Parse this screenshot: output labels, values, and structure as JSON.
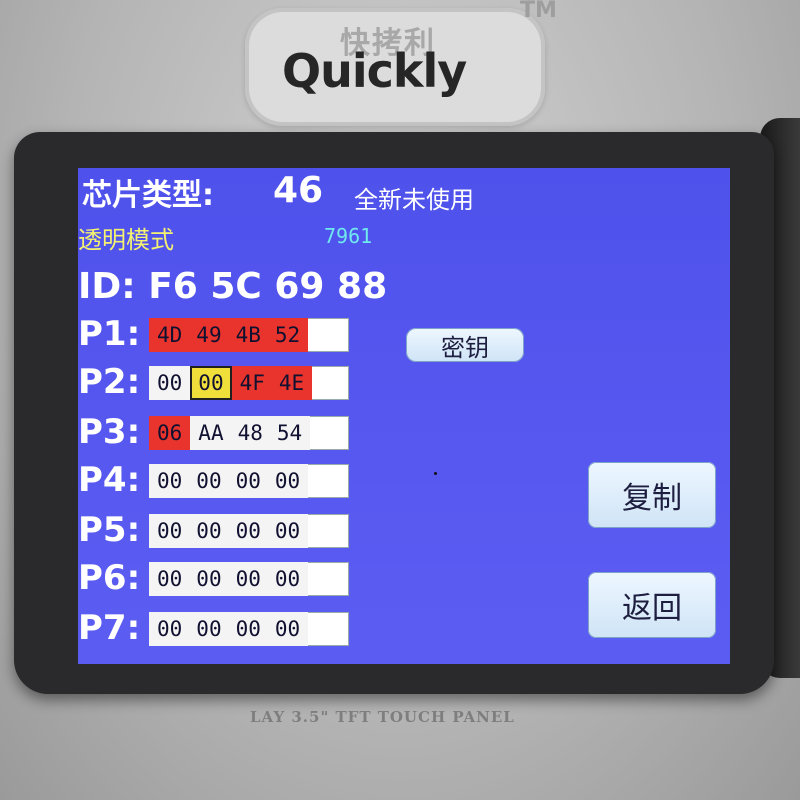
{
  "brand": {
    "cn": "快拷利",
    "en": "Quickly",
    "tm": "TM",
    "panel_label": "LAY 3.5\" TFT TOUCH PANEL"
  },
  "screen": {
    "chip_type_label": "芯片类型:",
    "chip_type_value": "46",
    "chip_status": "全新未使用",
    "mode": "透明模式",
    "code": "7961",
    "id": "ID: F6 5C 69 88",
    "pages": [
      {
        "label": "P1:",
        "segments": [
          {
            "color": "#e8342c",
            "bytes": [
              "4D",
              "49",
              "4B",
              "52"
            ]
          }
        ]
      },
      {
        "label": "P2:",
        "segments": [
          {
            "color": "#f4f4f4",
            "bytes": [
              "00"
            ]
          },
          {
            "color": "#f0de3a",
            "bytes": [
              "00"
            ]
          },
          {
            "color": "#e8342c",
            "bytes": [
              "4F",
              "4E"
            ]
          }
        ]
      },
      {
        "label": "P3:",
        "segments": [
          {
            "color": "#e8342c",
            "bytes": [
              "06"
            ]
          },
          {
            "color": "#f4f4f4",
            "bytes": [
              "AA",
              "48",
              "54"
            ]
          }
        ]
      },
      {
        "label": "P4:",
        "segments": [
          {
            "color": "#f4f4f4",
            "bytes": [
              "00",
              "00",
              "00",
              "00"
            ]
          }
        ]
      },
      {
        "label": "P5:",
        "segments": [
          {
            "color": "#f4f4f4",
            "bytes": [
              "00",
              "00",
              "00",
              "00"
            ]
          }
        ]
      },
      {
        "label": "P6:",
        "segments": [
          {
            "color": "#f4f4f4",
            "bytes": [
              "00",
              "00",
              "00",
              "00"
            ]
          }
        ]
      },
      {
        "label": "P7:",
        "segments": [
          {
            "color": "#f4f4f4",
            "bytes": [
              "00",
              "00",
              "00",
              "00"
            ]
          }
        ]
      }
    ],
    "buttons": {
      "key": "密钥",
      "copy": "复制",
      "back": "返回"
    }
  }
}
